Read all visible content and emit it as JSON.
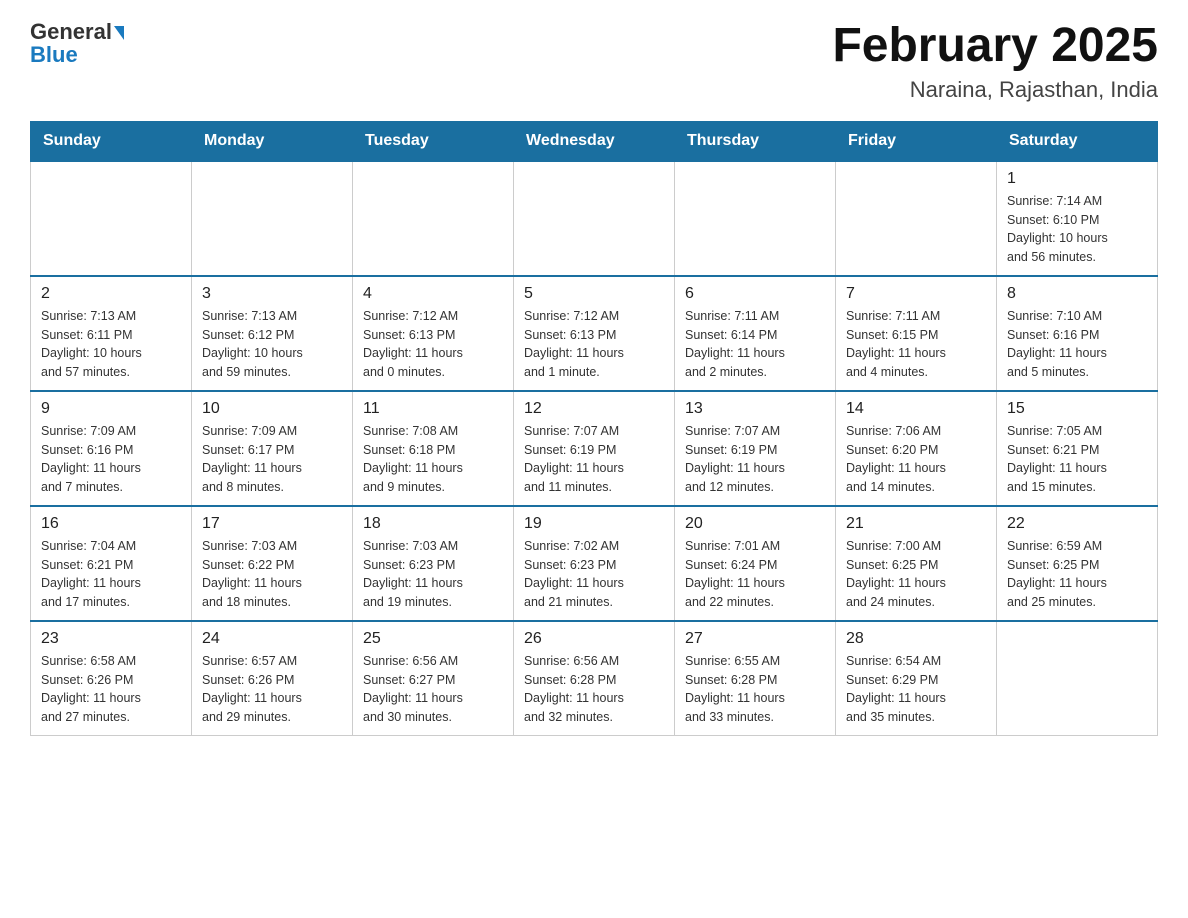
{
  "header": {
    "logo_general": "General",
    "logo_blue": "Blue",
    "title": "February 2025",
    "subtitle": "Naraina, Rajasthan, India"
  },
  "weekdays": [
    "Sunday",
    "Monday",
    "Tuesday",
    "Wednesday",
    "Thursday",
    "Friday",
    "Saturday"
  ],
  "weeks": [
    [
      {
        "day": "",
        "info": ""
      },
      {
        "day": "",
        "info": ""
      },
      {
        "day": "",
        "info": ""
      },
      {
        "day": "",
        "info": ""
      },
      {
        "day": "",
        "info": ""
      },
      {
        "day": "",
        "info": ""
      },
      {
        "day": "1",
        "info": "Sunrise: 7:14 AM\nSunset: 6:10 PM\nDaylight: 10 hours\nand 56 minutes."
      }
    ],
    [
      {
        "day": "2",
        "info": "Sunrise: 7:13 AM\nSunset: 6:11 PM\nDaylight: 10 hours\nand 57 minutes."
      },
      {
        "day": "3",
        "info": "Sunrise: 7:13 AM\nSunset: 6:12 PM\nDaylight: 10 hours\nand 59 minutes."
      },
      {
        "day": "4",
        "info": "Sunrise: 7:12 AM\nSunset: 6:13 PM\nDaylight: 11 hours\nand 0 minutes."
      },
      {
        "day": "5",
        "info": "Sunrise: 7:12 AM\nSunset: 6:13 PM\nDaylight: 11 hours\nand 1 minute."
      },
      {
        "day": "6",
        "info": "Sunrise: 7:11 AM\nSunset: 6:14 PM\nDaylight: 11 hours\nand 2 minutes."
      },
      {
        "day": "7",
        "info": "Sunrise: 7:11 AM\nSunset: 6:15 PM\nDaylight: 11 hours\nand 4 minutes."
      },
      {
        "day": "8",
        "info": "Sunrise: 7:10 AM\nSunset: 6:16 PM\nDaylight: 11 hours\nand 5 minutes."
      }
    ],
    [
      {
        "day": "9",
        "info": "Sunrise: 7:09 AM\nSunset: 6:16 PM\nDaylight: 11 hours\nand 7 minutes."
      },
      {
        "day": "10",
        "info": "Sunrise: 7:09 AM\nSunset: 6:17 PM\nDaylight: 11 hours\nand 8 minutes."
      },
      {
        "day": "11",
        "info": "Sunrise: 7:08 AM\nSunset: 6:18 PM\nDaylight: 11 hours\nand 9 minutes."
      },
      {
        "day": "12",
        "info": "Sunrise: 7:07 AM\nSunset: 6:19 PM\nDaylight: 11 hours\nand 11 minutes."
      },
      {
        "day": "13",
        "info": "Sunrise: 7:07 AM\nSunset: 6:19 PM\nDaylight: 11 hours\nand 12 minutes."
      },
      {
        "day": "14",
        "info": "Sunrise: 7:06 AM\nSunset: 6:20 PM\nDaylight: 11 hours\nand 14 minutes."
      },
      {
        "day": "15",
        "info": "Sunrise: 7:05 AM\nSunset: 6:21 PM\nDaylight: 11 hours\nand 15 minutes."
      }
    ],
    [
      {
        "day": "16",
        "info": "Sunrise: 7:04 AM\nSunset: 6:21 PM\nDaylight: 11 hours\nand 17 minutes."
      },
      {
        "day": "17",
        "info": "Sunrise: 7:03 AM\nSunset: 6:22 PM\nDaylight: 11 hours\nand 18 minutes."
      },
      {
        "day": "18",
        "info": "Sunrise: 7:03 AM\nSunset: 6:23 PM\nDaylight: 11 hours\nand 19 minutes."
      },
      {
        "day": "19",
        "info": "Sunrise: 7:02 AM\nSunset: 6:23 PM\nDaylight: 11 hours\nand 21 minutes."
      },
      {
        "day": "20",
        "info": "Sunrise: 7:01 AM\nSunset: 6:24 PM\nDaylight: 11 hours\nand 22 minutes."
      },
      {
        "day": "21",
        "info": "Sunrise: 7:00 AM\nSunset: 6:25 PM\nDaylight: 11 hours\nand 24 minutes."
      },
      {
        "day": "22",
        "info": "Sunrise: 6:59 AM\nSunset: 6:25 PM\nDaylight: 11 hours\nand 25 minutes."
      }
    ],
    [
      {
        "day": "23",
        "info": "Sunrise: 6:58 AM\nSunset: 6:26 PM\nDaylight: 11 hours\nand 27 minutes."
      },
      {
        "day": "24",
        "info": "Sunrise: 6:57 AM\nSunset: 6:26 PM\nDaylight: 11 hours\nand 29 minutes."
      },
      {
        "day": "25",
        "info": "Sunrise: 6:56 AM\nSunset: 6:27 PM\nDaylight: 11 hours\nand 30 minutes."
      },
      {
        "day": "26",
        "info": "Sunrise: 6:56 AM\nSunset: 6:28 PM\nDaylight: 11 hours\nand 32 minutes."
      },
      {
        "day": "27",
        "info": "Sunrise: 6:55 AM\nSunset: 6:28 PM\nDaylight: 11 hours\nand 33 minutes."
      },
      {
        "day": "28",
        "info": "Sunrise: 6:54 AM\nSunset: 6:29 PM\nDaylight: 11 hours\nand 35 minutes."
      },
      {
        "day": "",
        "info": ""
      }
    ]
  ]
}
